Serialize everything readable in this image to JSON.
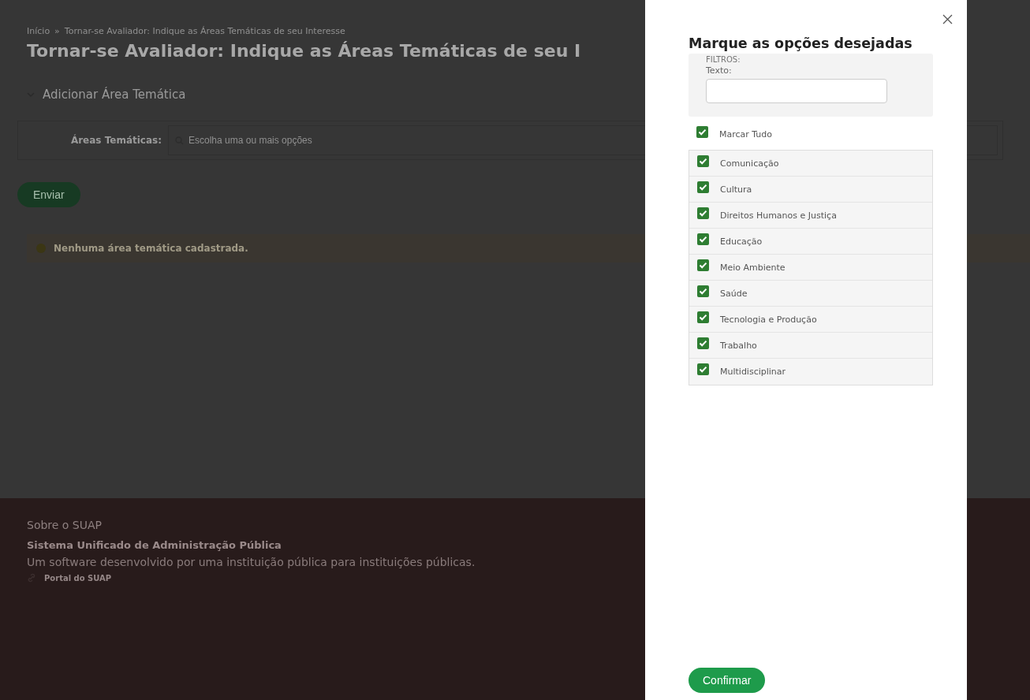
{
  "breadcrumb": {
    "items": [
      "Início",
      "Tornar-se Avaliador: Indique as Áreas Temáticas de seu Interesse"
    ],
    "separator": "»"
  },
  "page_title": "Tornar-se Avaliador: Indique as Áreas Temáticas de seu I",
  "section": {
    "label": "Adicionar Área Temática"
  },
  "form": {
    "label": "Áreas Temáticas:",
    "placeholder": "Escolha uma ou mais opções"
  },
  "submit_button": "Enviar",
  "alert": {
    "text": "Nenhuma área temática cadastrada."
  },
  "footer": {
    "heading": "Sobre o SUAP",
    "name": "Sistema Unificado de Administração Pública",
    "description": "Um software desenvolvido por uma instituição pública para instituições públicas.",
    "link": "Portal do SUAP"
  },
  "drawer": {
    "title": "Marque as opções desejadas",
    "filters_label": "FILTROS:",
    "text_label": "Texto:",
    "select_all": {
      "label": "Marcar Tudo",
      "checked": true
    },
    "options": [
      {
        "label": "Comunicação",
        "checked": true
      },
      {
        "label": "Cultura",
        "checked": true
      },
      {
        "label": "Direitos Humanos e Justiça",
        "checked": true
      },
      {
        "label": "Educação",
        "checked": true
      },
      {
        "label": "Meio Ambiente",
        "checked": true
      },
      {
        "label": "Saúde",
        "checked": true
      },
      {
        "label": "Tecnologia e Produção",
        "checked": true
      },
      {
        "label": "Trabalho",
        "checked": true
      },
      {
        "label": "Multidisciplinar",
        "checked": true
      }
    ],
    "confirm_button": "Confirmar"
  }
}
